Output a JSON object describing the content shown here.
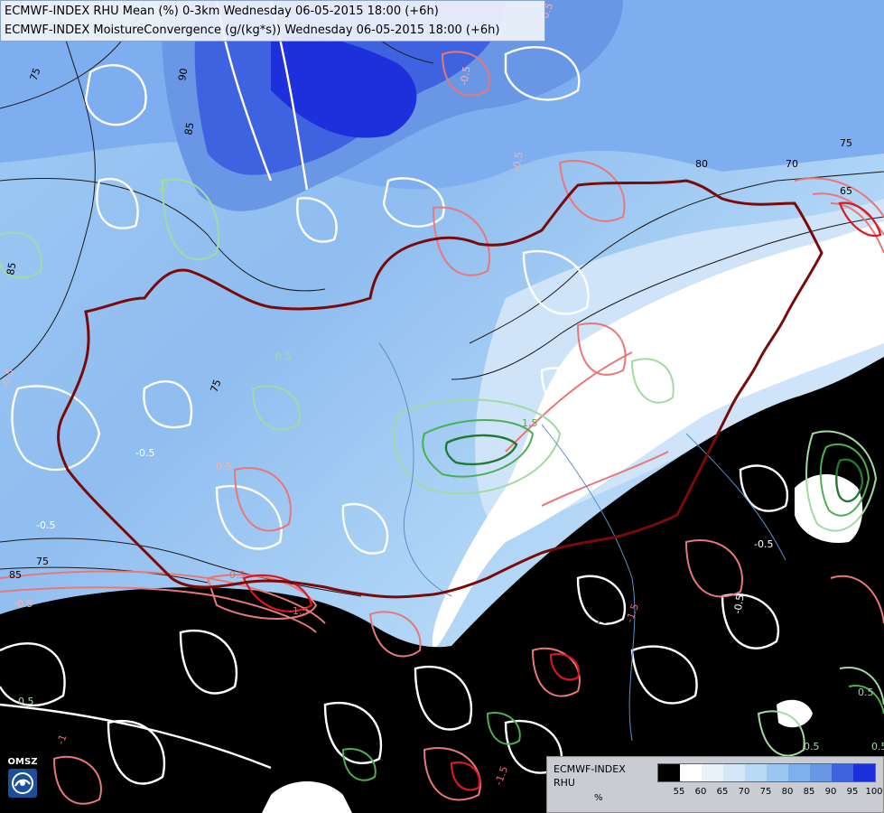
{
  "title": {
    "line1": "ECMWF-INDEX RHU Mean (%) 0-3km Wednesday 06-05-2015 18:00 (+6h)",
    "line2": "ECMWF-INDEX MoistureConvergence (g/(kg*s)) Wednesday 06-05-2015 18:00 (+6h)"
  },
  "logo": {
    "text": "OMSZ",
    "icon": "omsz-logo-icon"
  },
  "legend": {
    "name": "ECMWF-INDEX\nRHU",
    "unit": "%",
    "ticks": [
      "55",
      "60",
      "65",
      "70",
      "75",
      "80",
      "85",
      "90",
      "95",
      "100"
    ],
    "colors": [
      "#000000",
      "#ffffff",
      "#e8f2fb",
      "#d3e7f8",
      "#b9daf6",
      "#9ac7f2",
      "#7fb0ec",
      "#6a96e6",
      "#3f63e0",
      "#1e2fdc"
    ]
  },
  "contour_labels": {
    "rhu": [
      "75",
      "90",
      "85",
      "80",
      "75",
      "70",
      "65",
      "85",
      "75",
      "75",
      "85",
      "75",
      "70"
    ],
    "convergence": [
      "-0.5",
      "-0.5",
      "-0.5",
      "0.5",
      "-0.5",
      "0.5",
      "-0.5",
      "-0.5",
      "-0.5",
      "1.5",
      "-0.5",
      "-1.5",
      "-0.5",
      "0.5",
      "-0.5",
      "-1.5",
      "0.5",
      "-1",
      "-1.5",
      "0.5",
      "0.5",
      "-0.5"
    ]
  },
  "colors": {
    "border": "#7a0a0a",
    "positive_convergence": "#3fa84b",
    "negative_convergence": "#e86a6a"
  }
}
